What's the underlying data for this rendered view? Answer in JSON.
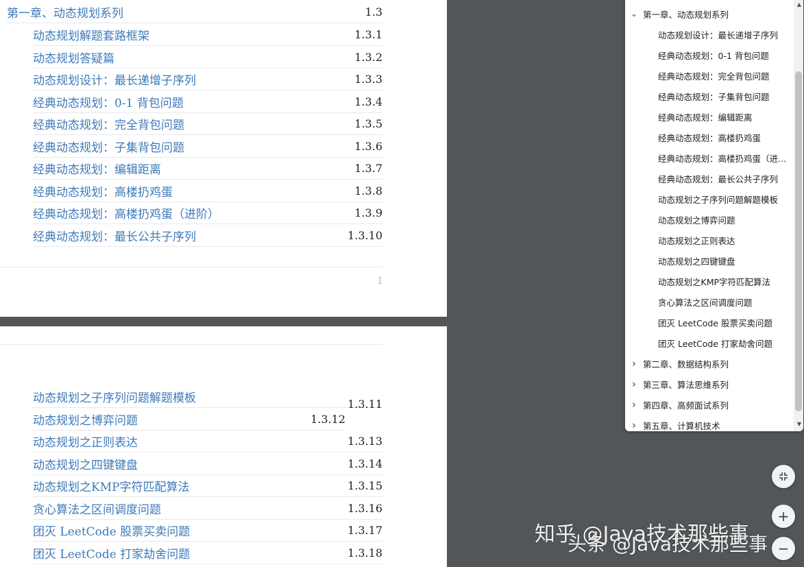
{
  "page1": {
    "chapter": {
      "title": "第一章、动态规划系列",
      "num": "1.3"
    },
    "entries": [
      {
        "title": "动态规划解题套路框架",
        "num": "1.3.1"
      },
      {
        "title": "动态规划答疑篇",
        "num": "1.3.2"
      },
      {
        "title": "动态规划设计：最长递增子序列",
        "num": "1.3.3"
      },
      {
        "title": "经典动态规划：0-1 背包问题",
        "num": "1.3.4"
      },
      {
        "title": "经典动态规划：完全背包问题",
        "num": "1.3.5"
      },
      {
        "title": "经典动态规划：子集背包问题",
        "num": "1.3.6"
      },
      {
        "title": "经典动态规划：编辑距离",
        "num": "1.3.7"
      },
      {
        "title": "经典动态规划：高楼扔鸡蛋",
        "num": "1.3.8"
      },
      {
        "title": "经典动态规划：高楼扔鸡蛋（进阶）",
        "num": "1.3.9"
      },
      {
        "title": "经典动态规划：最长公共子序列",
        "num": "1.3.10"
      }
    ],
    "page_number": "1"
  },
  "page2": {
    "entries": [
      {
        "title": "动态规划之子序列问题解题模板",
        "num": "1.3.11"
      },
      {
        "title": "动态规划之博弈问题",
        "num": "1.3.12"
      },
      {
        "title": "动态规划之正则表达",
        "num": "1.3.13"
      },
      {
        "title": "动态规划之四键键盘",
        "num": "1.3.14"
      },
      {
        "title": "动态规划之KMP字符匹配算法",
        "num": "1.3.15"
      },
      {
        "title": "贪心算法之区间调度问题",
        "num": "1.3.16"
      },
      {
        "title": "团灭 LeetCode 股票买卖问题",
        "num": "1.3.17"
      },
      {
        "title": "团灭 LeetCode 打家劫舍问题",
        "num": "1.3.18"
      }
    ]
  },
  "outline": {
    "expanded_chapter": "第一章、动态规划系列",
    "children": [
      "动态规划设计：最长递增子序列",
      "经典动态规划：0-1 背包问题",
      "经典动态规划：完全背包问题",
      "经典动态规划：子集背包问题",
      "经典动态规划：编辑距离",
      "经典动态规划：高楼扔鸡蛋",
      "经典动态规划：高楼扔鸡蛋（进...",
      "经典动态规划：最长公共子序列",
      "动态规划之子序列问题解题模板",
      "动态规划之博弈问题",
      "动态规划之正则表达",
      "动态规划之四键键盘",
      "动态规划之KMP字符匹配算法",
      "贪心算法之区间调度问题",
      "团灭 LeetCode 股票买卖问题",
      "团灭 LeetCode 打家劫舍问题"
    ],
    "collapsed_chapters": [
      "第二章、数据结构系列",
      "第三章、算法思维系列",
      "第四章、高频面试系列",
      "第五章、计算机技术"
    ]
  },
  "controls": {
    "fit_icon": "fit-to-page-icon",
    "zoom_in_label": "+",
    "zoom_out_label": "−"
  },
  "watermarks": [
    "知乎 @Java技术那些事",
    "头条 @Java技术那些事"
  ]
}
